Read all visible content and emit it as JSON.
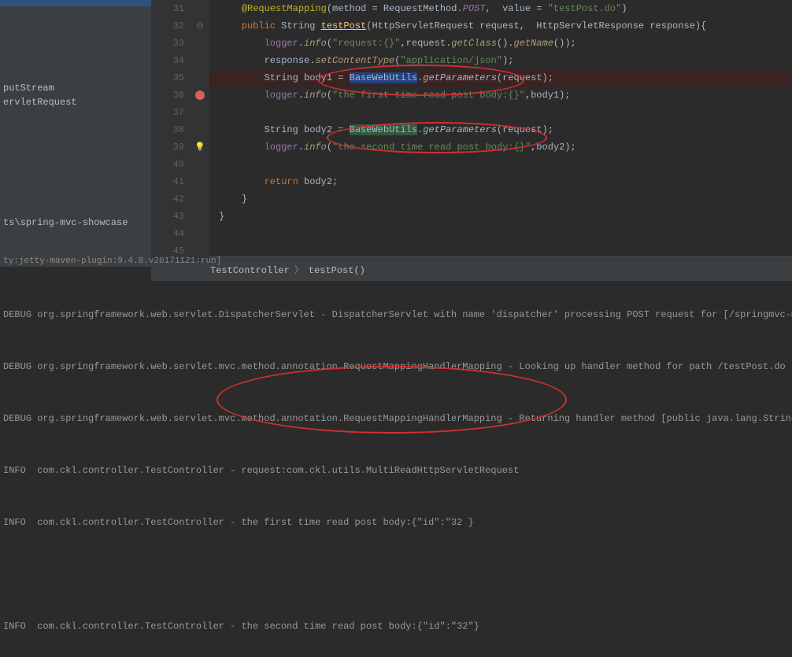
{
  "left_panel": {
    "item1": "putStream",
    "item2": "ervletRequest",
    "bottom": "ts\\spring-mvc-showcase"
  },
  "gutter": [
    "31",
    "32",
    "33",
    "34",
    "35",
    "36",
    "37",
    "38",
    "39",
    "40",
    "41",
    "42",
    "43",
    "44",
    "45"
  ],
  "code": {
    "l31": {
      "ann": "@RequestMapping",
      "p1": "(",
      "k1": "method = ",
      "m": "RequestMethod",
      "dot": ".",
      "post": "POST",
      "c1": ",  ",
      "k2": "value = ",
      "s": "\"testPost.do\"",
      "p2": ")"
    },
    "l32": {
      "k": "public ",
      "t": "String ",
      "m": "testPost",
      "p1": "(HttpServletRequest request,  HttpServletResponse response)",
      "b": "{"
    },
    "l33": {
      "f": "logger",
      "dot": ".",
      "m": "info",
      "p1": "(",
      "s": "\"request:{}\"",
      "c": ",request.",
      "m2": "getClass",
      "p2": "().",
      "m3": "getName",
      "p3": "());"
    },
    "l34": {
      "v": "response.",
      "m": "setContentType",
      "p1": "(",
      "s": "\"application/json\"",
      "p2": ");"
    },
    "l35": {
      "t": "String ",
      "v": "body1 ",
      "eq": "= ",
      "cls": "BaseWebUtils",
      "dot": ".",
      "m": "getParameters",
      "p1": "(request)",
      ";": ";"
    },
    "l36": {
      "f": "logger",
      "dot": ".",
      "m": "info",
      "p1": "(",
      "s": "\"the first time read post body:{}\"",
      "c": ",body1);"
    },
    "l38": {
      "t": "String ",
      "v": "body2 ",
      "eq": "= ",
      "cls": "BaseWebUtils",
      "dot": ".",
      "m": "getParameters",
      "p1": "(request);"
    },
    "l39": {
      "f": "logger",
      "dot": ".",
      "m": "info",
      "p1": "(",
      "s": "\"the second time read post body:{}\"",
      "c": ",body2);"
    },
    "l41": {
      "k": "return ",
      "v": "body2;"
    },
    "l42": "}",
    "l43": "}"
  },
  "breadcrumb": {
    "a": "TestController",
    "b": "testPost()"
  },
  "console_header": "ty:jetty-maven-plugin:9.4.8.v20171121:run]",
  "console": [
    "DEBUG org.springframework.web.servlet.DispatcherServlet - DispatcherServlet with name 'dispatcher' processing POST request for [/springmvc-mult",
    "DEBUG org.springframework.web.servlet.mvc.method.annotation.RequestMappingHandlerMapping - Looking up handler method for path /testPost.do",
    "DEBUG org.springframework.web.servlet.mvc.method.annotation.RequestMappingHandlerMapping - Returning handler method [public java.lang.String co",
    "INFO  com.ckl.controller.TestController - request:com.ckl.utils.MultiReadHttpServletRequest",
    "INFO  com.ckl.controller.TestController - the first time read post body:{\"id\":\"32 }",
    "",
    "INFO  com.ckl.controller.TestController - the second time read post body:{\"id\":\"32\"}"
  ]
}
